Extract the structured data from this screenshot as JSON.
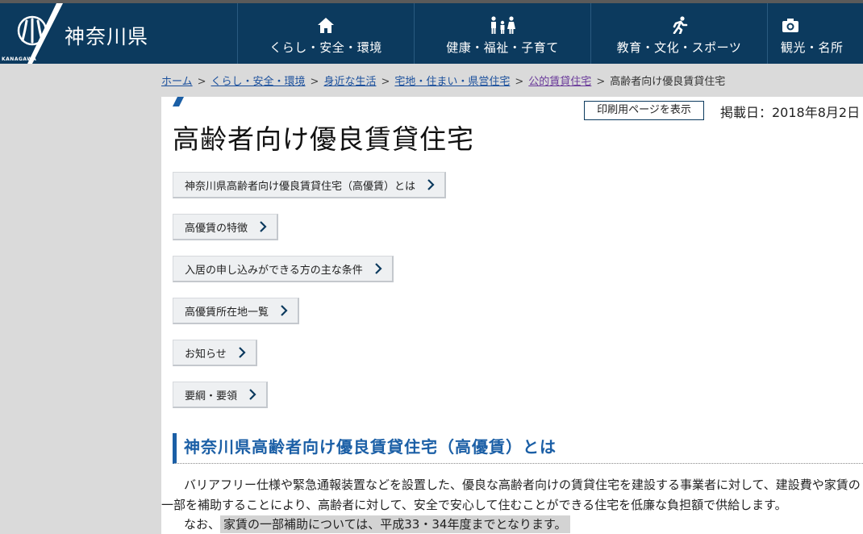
{
  "header": {
    "site_name": "神奈川県",
    "logo_text": "KANAGAWA",
    "nav": [
      {
        "label": "くらし・安全・環境",
        "icon": "house-icon"
      },
      {
        "label": "健康・福祉・子育て",
        "icon": "family-icon"
      },
      {
        "label": "教育・文化・スポーツ",
        "icon": "runner-icon"
      },
      {
        "label": "観光・名所",
        "icon": "camera-icon"
      }
    ]
  },
  "breadcrumb": {
    "items": [
      "ホーム",
      "くらし・安全・環境",
      "身近な生活",
      "宅地・住まい・県営住宅",
      "公的賃貸住宅"
    ],
    "current": "高齢者向け優良賃貸住宅",
    "separator": ">"
  },
  "page": {
    "print_label": "印刷用ページを表示",
    "published": "掲載日：2018年8月2日",
    "title": "高齢者向け優良賃貸住宅"
  },
  "anchors": [
    "神奈川県高齢者向け優良賃貸住宅（高優賃）とは",
    "高優賃の特徴",
    "入居の申し込みができる方の主な条件",
    "高優賃所在地一覧",
    "お知らせ",
    "要綱・要領"
  ],
  "section": {
    "heading": "神奈川県高齢者向け優良賃貸住宅（高優賃）とは",
    "line1": "バリアフリー仕様や緊急通報装置などを設置した、優良な高齢者向けの賃貸住宅を建設する事業者に対して、建設費や家賃の",
    "line2": "一部を補助することにより、高齢者に対して、安全で安心して住むことができる住宅を低廉な負担額で供給します。",
    "line3_prefix": "なお、",
    "line3_highlight": "家賃の一部補助については、平成33・34年度までとなります。"
  },
  "colors": {
    "header_bg": "#0c3a5e",
    "accent_blue": "#1b5fa6",
    "link": "#1a4f9c",
    "visited_link": "#6a3a9a"
  }
}
